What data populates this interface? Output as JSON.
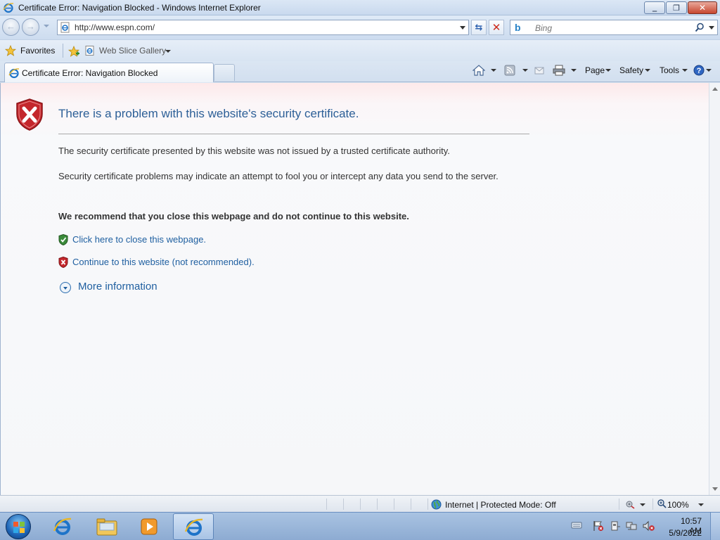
{
  "window": {
    "title": "Certificate Error: Navigation Blocked - Windows Internet Explorer"
  },
  "navigation": {
    "address": "http://www.espn.com/",
    "search_placeholder": "Bing"
  },
  "favorites_bar": {
    "favorites_label": "Favorites",
    "web_slice_label": "Web Slice Gallery"
  },
  "tab": {
    "label": "Certificate Error: Navigation Blocked"
  },
  "command_bar": {
    "page_label": "Page",
    "safety_label": "Safety",
    "tools_label": "Tools"
  },
  "page": {
    "title": "There is a problem with this website's security certificate.",
    "paragraph1": "The security certificate presented by this website was not issued by a trusted certificate authority.",
    "paragraph2": "Security certificate problems may indicate an attempt to fool you or intercept any data you send to the server.",
    "recommendation": "We recommend that you close this webpage and do not continue to this website.",
    "close_link": "Click here to close this webpage.",
    "continue_link": "Continue to this website (not recommended).",
    "more_info": "More information"
  },
  "status_bar": {
    "zone": "Internet | Protected Mode: Off",
    "zoom": "100%"
  },
  "taskbar": {
    "time": "10:57 AM",
    "date": "5/9/2022"
  },
  "colors": {
    "link": "#1f5fa0",
    "title": "#2c5f97",
    "error_red": "#c4272c",
    "safe_green": "#3a8a3a"
  }
}
